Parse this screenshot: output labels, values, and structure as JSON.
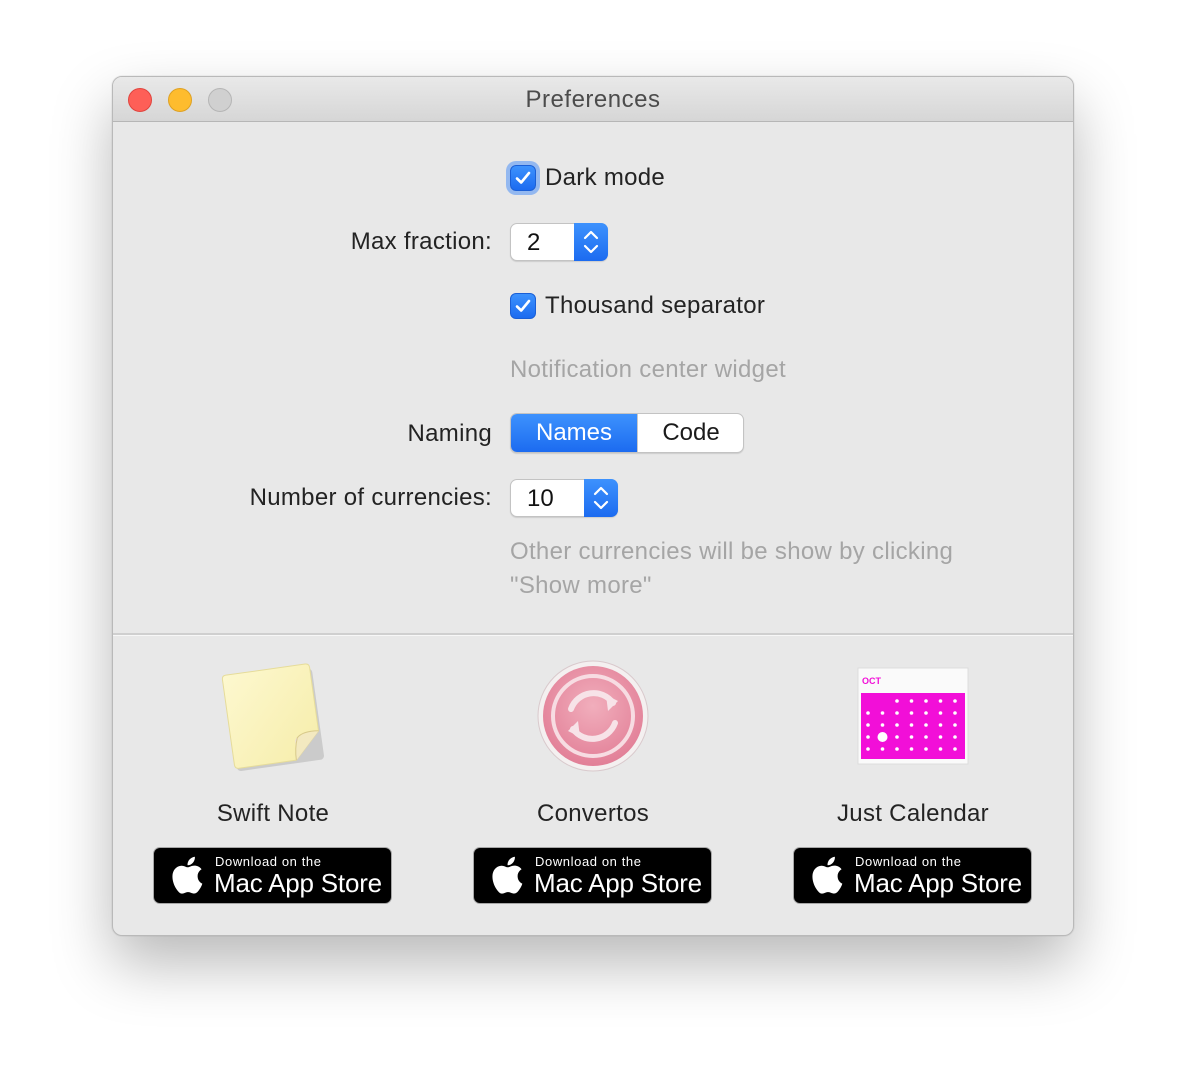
{
  "window": {
    "title": "Preferences"
  },
  "settings": {
    "dark_mode_label": "Dark mode",
    "dark_mode_checked": true,
    "max_fraction_label": "Max fraction:",
    "max_fraction_value": "2",
    "thousand_separator_label": "Thousand separator",
    "thousand_separator_checked": true,
    "notification_widget_label": "Notification center widget",
    "naming_label": "Naming",
    "naming_options": [
      "Names",
      "Code"
    ],
    "naming_selected": "Names",
    "num_currencies_label": "Number of currencies:",
    "num_currencies_value": "10",
    "hint_line1": "Other currencies will be show by clicking",
    "hint_line2": "\"Show more\""
  },
  "apps": [
    {
      "name": "Swift Note",
      "badge_small": "Download on the",
      "badge_big": "Mac App Store",
      "icon": "note-icon"
    },
    {
      "name": "Convertos",
      "badge_small": "Download on the",
      "badge_big": "Mac App Store",
      "icon": "convert-icon"
    },
    {
      "name": "Just Calendar",
      "badge_small": "Download on the",
      "badge_big": "Mac App Store",
      "icon": "calendar-icon",
      "icon_text": "OCT"
    }
  ],
  "colors": {
    "accent": "#1c6bf0",
    "calendar": "#f20fd8",
    "convertos": "#e88aa0"
  }
}
